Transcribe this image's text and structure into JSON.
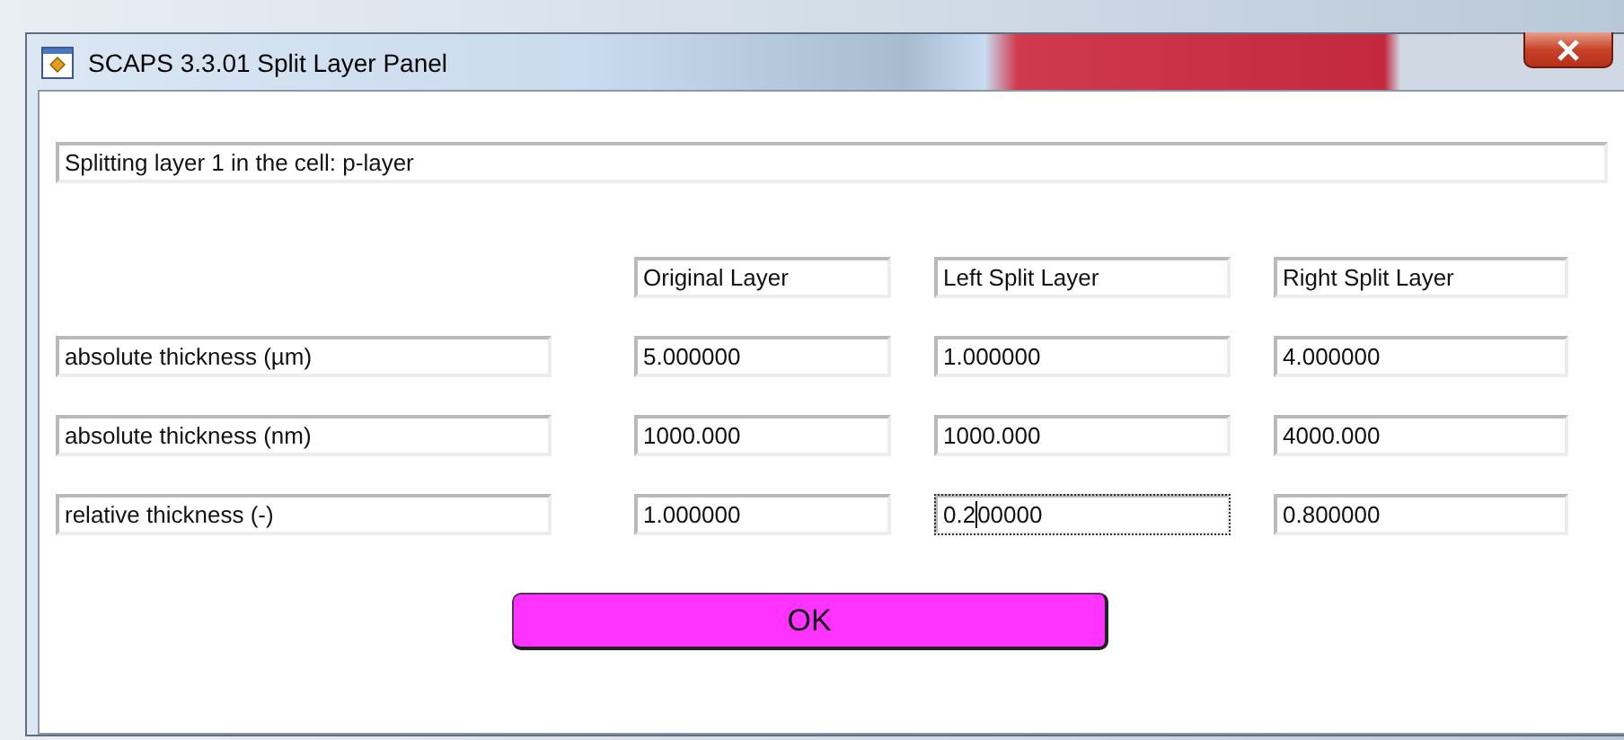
{
  "window": {
    "title": "SCAPS 3.3.01 Split Layer Panel"
  },
  "message": "Splitting layer 1 in the cell: p-layer",
  "columns": [
    "Original Layer",
    "Left Split Layer",
    "Right Split Layer"
  ],
  "rows": [
    {
      "label": "absolute thickness (µm)",
      "values": [
        {
          "text": "5.000000",
          "focused": false
        },
        {
          "text": "1.000000",
          "focused": false
        },
        {
          "text": "4.000000",
          "focused": false
        }
      ]
    },
    {
      "label": "absolute thickness (nm)",
      "values": [
        {
          "text": "1000.000",
          "focused": false
        },
        {
          "text": "1000.000",
          "focused": false
        },
        {
          "text": "4000.000",
          "focused": false
        }
      ]
    },
    {
      "label": "relative thickness (-)",
      "values": [
        {
          "text": "1.000000",
          "focused": false
        },
        {
          "text": "0.200000",
          "focused": true
        },
        {
          "text": "0.800000",
          "focused": false
        }
      ]
    }
  ],
  "ok_button": "OK"
}
